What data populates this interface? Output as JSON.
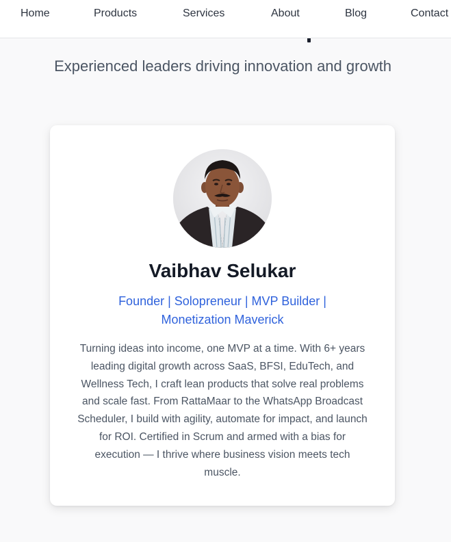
{
  "nav": {
    "items": [
      {
        "label": "Home"
      },
      {
        "label": "Products"
      },
      {
        "label": "Services"
      },
      {
        "label": "About"
      },
      {
        "label": "Blog"
      },
      {
        "label": "Contact"
      }
    ]
  },
  "section": {
    "subtitle": "Experienced leaders driving innovation and growth"
  },
  "profile": {
    "name": "Vaibhav Selukar",
    "role": "Founder | Solopreneur | MVP Builder | Monetization Maverick",
    "bio": "Turning ideas into income, one MVP at a time. With 6+ years leading digital growth across SaaS, BFSI, EduTech, and Wellness Tech, I craft lean products that solve real problems and scale fast. From RattaMaar to the WhatsApp Broadcast Scheduler, I build with agility, automate for impact, and launch for ROI. Certified in Scrum and armed with a bias for execution — I thrive where business vision meets tech muscle.",
    "photo": "avatar-photo"
  },
  "colors": {
    "accent": "#2f62dc",
    "heading": "#141a26",
    "body_text": "#4b5563",
    "page_bg": "#f9f9fa",
    "card_bg": "#ffffff"
  }
}
